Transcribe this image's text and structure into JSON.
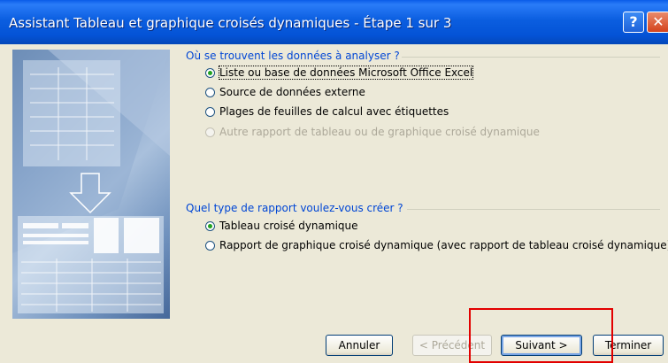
{
  "window": {
    "title": "Assistant Tableau et graphique croisés dynamiques - Étape 1 sur 3",
    "help_glyph": "?",
    "close_glyph": "✕"
  },
  "group1": {
    "title": "Où se trouvent les données à analyser ?",
    "options": [
      {
        "label": "Liste ou base de données Microsoft Office Excel",
        "checked": true,
        "enabled": true
      },
      {
        "label": "Source de données externe",
        "checked": false,
        "enabled": true
      },
      {
        "label": "Plages de feuilles de calcul avec étiquettes",
        "checked": false,
        "enabled": true
      },
      {
        "label": "Autre rapport de tableau ou de graphique croisé dynamique",
        "checked": false,
        "enabled": false
      }
    ]
  },
  "group2": {
    "title": "Quel type de rapport voulez-vous créer ?",
    "options": [
      {
        "label": "Tableau croisé dynamique",
        "checked": true,
        "enabled": true
      },
      {
        "label": "Rapport de graphique croisé dynamique (avec rapport de tableau croisé dynamique)",
        "checked": false,
        "enabled": true
      }
    ]
  },
  "buttons": {
    "cancel": "Annuler",
    "previous": "< Précédent",
    "next": "Suivant >",
    "finish": "Terminer"
  },
  "icons": [
    "help-icon",
    "close-icon",
    "wizard-illustration"
  ],
  "colors": {
    "titlebar": "#0453d6",
    "group_title": "#0046d5",
    "annotation": "#e20000"
  }
}
